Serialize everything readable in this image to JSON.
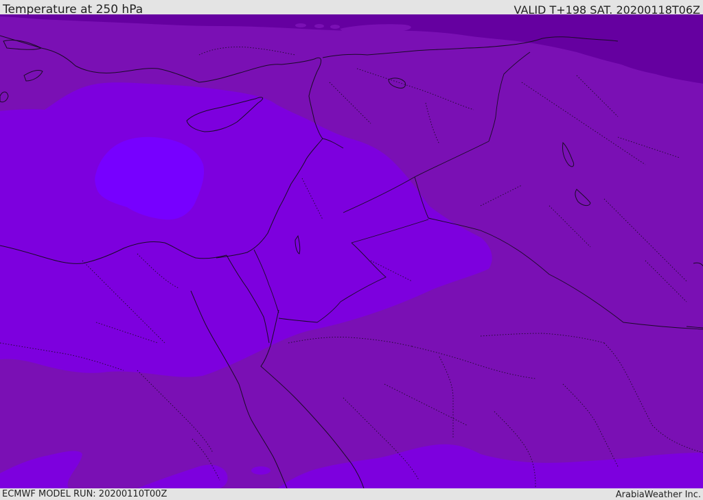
{
  "header": {
    "title": "Temperature at 250 hPa",
    "valid_time": "VALID T+198 SAT. 20200118T06Z"
  },
  "footer": {
    "model_run": "ECMWF MODEL RUN: 20200110T00Z",
    "provider": "ArabiaWeather Inc."
  },
  "map": {
    "level": "250 hPa",
    "field": "Temperature",
    "colors": {
      "darkest_band": "#6500a0",
      "dark_band": "#7a10b4",
      "mid_band": "#7d00de",
      "warm_core": "#7700ff",
      "borders": "#1a0a26"
    }
  }
}
